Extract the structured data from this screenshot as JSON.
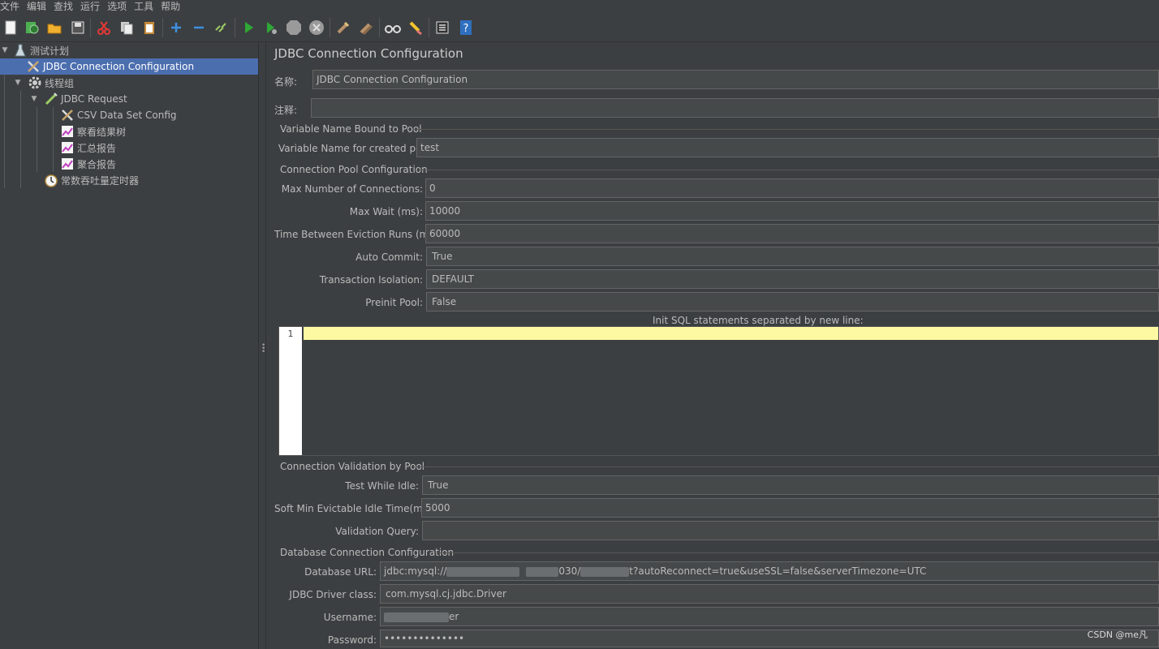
{
  "menu": [
    "文件",
    "编辑",
    "查找",
    "运行",
    "选项",
    "工具",
    "帮助"
  ],
  "toolbar": {
    "icons": [
      "new-icon",
      "templates-icon",
      "open-icon",
      "save-icon",
      "cut-icon",
      "copy-icon",
      "paste-icon",
      "expand-icon",
      "collapse-icon",
      "toggle-icon",
      "start-icon",
      "start-no-pause-icon",
      "stop-icon",
      "shutdown-icon",
      "clear-icon",
      "clear-all-icon",
      "search-icon",
      "reset-search-icon",
      "function-helper-icon",
      "help-icon"
    ]
  },
  "tree": {
    "items": [
      {
        "label": "测试计划",
        "icon": "test-plan-icon"
      },
      {
        "label": "JDBC Connection Configuration",
        "icon": "config-icon"
      },
      {
        "label": "线程组",
        "icon": "thread-group-icon"
      },
      {
        "label": "JDBC Request",
        "icon": "sampler-icon"
      },
      {
        "label": "CSV Data Set Config",
        "icon": "config-icon"
      },
      {
        "label": "察看结果树",
        "icon": "listener-icon"
      },
      {
        "label": "汇总报告",
        "icon": "listener-icon"
      },
      {
        "label": "聚合报告",
        "icon": "listener-icon"
      },
      {
        "label": "常数吞吐量定时器",
        "icon": "timer-icon"
      }
    ]
  },
  "main": {
    "title": "JDBC Connection Configuration",
    "name_label": "名称:",
    "name_value": "JDBC Connection Configuration",
    "comment_label": "注释:",
    "comment_value": "",
    "sec_variable": "Variable Name Bound to Pool",
    "var_label": "Variable Name for created pool:",
    "var_value": "test",
    "sec_pool": "Connection Pool Configuration",
    "max_conn_label": "Max Number of Connections:",
    "max_conn_value": "0",
    "max_wait_label": "Max Wait (ms):",
    "max_wait_value": "10000",
    "eviction_label": "Time Between Eviction Runs (ms):",
    "eviction_value": "60000",
    "auto_commit_label": "Auto Commit:",
    "auto_commit_value": "True",
    "isolation_label": "Transaction Isolation:",
    "isolation_value": "DEFAULT",
    "preinit_label": "Preinit Pool:",
    "preinit_value": "False",
    "init_sql_label": "Init SQL statements separated by new line:",
    "line_number": "1",
    "sec_validation": "Connection Validation by Pool",
    "test_idle_label": "Test While Idle:",
    "test_idle_value": "True",
    "soft_min_label": "Soft Min Evictable Idle Time(ms):",
    "soft_min_value": "5000",
    "validation_query_label": "Validation Query:",
    "validation_query_value": "",
    "sec_db": "Database Connection Configuration",
    "db_url_label": "Database URL:",
    "db_url_prefix": "jdbc:mysql://",
    "db_url_mid": "030/",
    "db_url_suffix": "t?autoReconnect=true&useSSL=false&serverTimezone=UTC",
    "driver_label": "JDBC Driver class:",
    "driver_value": "com.mysql.cj.jdbc.Driver",
    "username_label": "Username:",
    "username_suffix": "er",
    "password_label": "Password:",
    "password_value": "••••••••••••••"
  },
  "watermark": "CSDN @me凡"
}
